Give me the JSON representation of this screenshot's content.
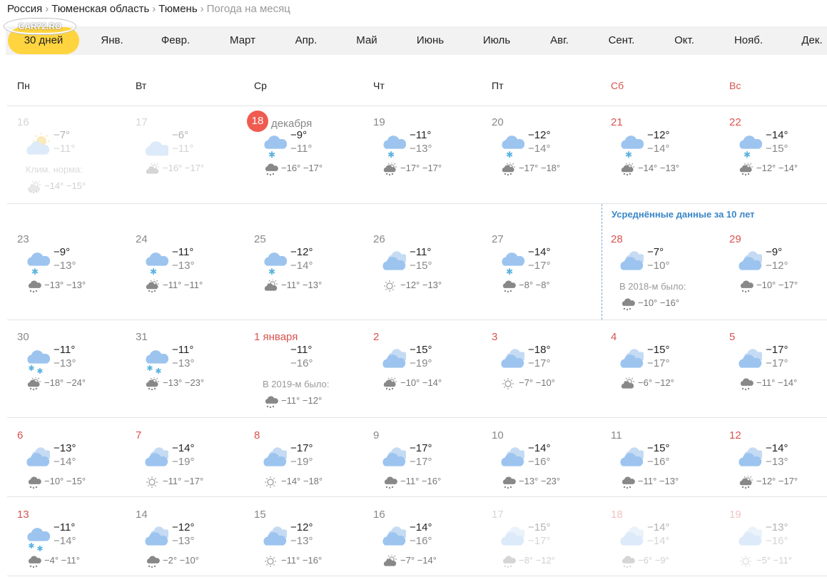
{
  "breadcrumb": [
    "Россия",
    "Тюменская область",
    "Тюмень"
  ],
  "breadcrumb_current": "Погода на месяц",
  "watermark": "CAR72.RO",
  "months": [
    "30 дней",
    "Янв.",
    "Февр.",
    "Март",
    "Апр.",
    "Май",
    "Июнь",
    "Июль",
    "Авг.",
    "Сент.",
    "Окт.",
    "Нояб.",
    "Дек."
  ],
  "active_month": "30 дней",
  "weekdays": [
    "Пн",
    "Вт",
    "Ср",
    "Чт",
    "Пт",
    "Сб",
    "Вс"
  ],
  "avg_label": "Усреднённые данные за 10 лет",
  "colors": {
    "accent": "#ffd43f",
    "today": "#f05b4f",
    "weekend": "#d9534f",
    "avg": "#3a86c8"
  },
  "days": [
    {
      "num": "16",
      "hi": "−7°",
      "lo": "−11°",
      "icon": "sun-cloud",
      "note": "Клим. норма:",
      "norm": "−14° −15°",
      "norm_icon": "sun-cloud-small",
      "faded": true
    },
    {
      "num": "17",
      "hi": "−6°",
      "lo": "−11°",
      "icon": "cloud",
      "norm": "−16° −17°",
      "norm_icon": "cloud-sun-small",
      "faded": true
    },
    {
      "num": "18",
      "month": "декабря",
      "today": true,
      "hi": "−9°",
      "lo": "−11°",
      "icon": "cloud-snow",
      "norm": "−16° −17°",
      "norm_icon": "cloud-snow-small"
    },
    {
      "num": "19",
      "hi": "−11°",
      "lo": "−13°",
      "icon": "cloud-snow",
      "norm": "−17° −17°",
      "norm_icon": "sun-cloud-snow-small"
    },
    {
      "num": "20",
      "hi": "−12°",
      "lo": "−14°",
      "icon": "cloud-snow",
      "norm": "−17° −18°",
      "norm_icon": "sun-cloud-snow-small"
    },
    {
      "num": "21",
      "hi": "−12°",
      "lo": "−14°",
      "icon": "cloud-snow",
      "norm": "−14° −13°",
      "norm_icon": "sun-cloud-snow-small",
      "weekend": true
    },
    {
      "num": "22",
      "hi": "−14°",
      "lo": "−15°",
      "icon": "cloud-snow",
      "norm": "−12° −14°",
      "norm_icon": "sun-cloud-snow-small",
      "weekend": true
    },
    {
      "num": "23",
      "hi": "−9°",
      "lo": "−13°",
      "icon": "cloud-snow",
      "norm": "−13° −13°",
      "norm_icon": "cloud-snow-small"
    },
    {
      "num": "24",
      "hi": "−11°",
      "lo": "−13°",
      "icon": "cloud-snow",
      "norm": "−11° −11°",
      "norm_icon": "sun-cloud-snow-small"
    },
    {
      "num": "25",
      "hi": "−12°",
      "lo": "−14°",
      "icon": "cloud-snow",
      "norm": "−11° −13°",
      "norm_icon": "cloud-sun-small"
    },
    {
      "num": "26",
      "hi": "−11°",
      "lo": "−15°",
      "icon": "clouds",
      "norm": "−12° −13°",
      "norm_icon": "sun-small"
    },
    {
      "num": "27",
      "hi": "−14°",
      "lo": "−17°",
      "icon": "cloud-snow",
      "norm": "−8° −8°",
      "norm_icon": "cloud-snow-small"
    },
    {
      "num": "28",
      "hi": "−7°",
      "lo": "−10°",
      "icon": "clouds",
      "note": "В 2018-м было:",
      "norm": "−10° −16°",
      "norm_icon": "cloud-snow-small",
      "weekend": true
    },
    {
      "num": "29",
      "hi": "−9°",
      "lo": "−12°",
      "icon": "clouds",
      "norm": "−10° −17°",
      "norm_icon": "cloud-snow-small",
      "weekend": true
    },
    {
      "num": "30",
      "hi": "−11°",
      "lo": "−13°",
      "icon": "cloud-snow-2",
      "norm": "−18° −24°",
      "norm_icon": "sun-cloud-snow-small"
    },
    {
      "num": "31",
      "hi": "−11°",
      "lo": "−13°",
      "icon": "cloud-snow-2",
      "norm": "−13° −23°",
      "norm_icon": "sun-cloud-snow-small"
    },
    {
      "num": "1 января",
      "hi": "−11°",
      "lo": "−16°",
      "icon": "none",
      "note": "В 2019-м было:",
      "norm": "−11° −12°",
      "norm_icon": "cloud-snow-small",
      "holiday": true
    },
    {
      "num": "2",
      "hi": "−15°",
      "lo": "−19°",
      "icon": "clouds",
      "norm": "−10° −14°",
      "norm_icon": "sun-cloud-snow-small",
      "holiday": true
    },
    {
      "num": "3",
      "hi": "−18°",
      "lo": "−17°",
      "icon": "clouds",
      "norm": "−7° −10°",
      "norm_icon": "sun-small",
      "holiday": true
    },
    {
      "num": "4",
      "hi": "−15°",
      "lo": "−17°",
      "icon": "clouds",
      "norm": "−6° −12°",
      "norm_icon": "cloud-sun-small",
      "holiday": true
    },
    {
      "num": "5",
      "hi": "−17°",
      "lo": "−17°",
      "icon": "clouds",
      "norm": "−11° −14°",
      "norm_icon": "cloud-snow-small",
      "holiday": true
    },
    {
      "num": "6",
      "hi": "−13°",
      "lo": "−14°",
      "icon": "clouds",
      "norm": "−10° −15°",
      "norm_icon": "cloud-snow-small",
      "holiday": true
    },
    {
      "num": "7",
      "hi": "−14°",
      "lo": "−19°",
      "icon": "clouds",
      "norm": "−11° −17°",
      "norm_icon": "sun-small",
      "holiday": true
    },
    {
      "num": "8",
      "hi": "−17°",
      "lo": "−19°",
      "icon": "clouds",
      "norm": "−14° −18°",
      "norm_icon": "sun-small",
      "holiday": true
    },
    {
      "num": "9",
      "hi": "−17°",
      "lo": "−17°",
      "icon": "clouds",
      "norm": "−11° −16°",
      "norm_icon": "cloud-snow-small"
    },
    {
      "num": "10",
      "hi": "−14°",
      "lo": "−16°",
      "icon": "clouds",
      "norm": "−13° −23°",
      "norm_icon": "cloud-snow-small"
    },
    {
      "num": "11",
      "hi": "−15°",
      "lo": "−16°",
      "icon": "clouds",
      "norm": "−11° −13°",
      "norm_icon": "cloud-snow-small"
    },
    {
      "num": "12",
      "hi": "−14°",
      "lo": "−13°",
      "icon": "clouds",
      "norm": "−12° −17°",
      "norm_icon": "sun-cloud-snow-small",
      "weekend": true
    },
    {
      "num": "13",
      "hi": "−11°",
      "lo": "−14°",
      "icon": "cloud-snow-2",
      "norm": "−4° −11°",
      "norm_icon": "cloud-snow-small",
      "weekend": true
    },
    {
      "num": "14",
      "hi": "−12°",
      "lo": "−13°",
      "icon": "clouds",
      "norm": "−2° −10°",
      "norm_icon": "cloud-snow-small"
    },
    {
      "num": "15",
      "hi": "−12°",
      "lo": "−13°",
      "icon": "clouds",
      "norm": "−11° −16°",
      "norm_icon": "sun-small"
    },
    {
      "num": "16",
      "hi": "−14°",
      "lo": "−16°",
      "icon": "clouds",
      "norm": "−7° −14°",
      "norm_icon": "cloud-sun-small"
    },
    {
      "num": "17",
      "hi": "−15°",
      "lo": "−17°",
      "icon": "clouds",
      "norm": "−8° −12°",
      "norm_icon": "cloud-snow-small",
      "faded": true
    },
    {
      "num": "18",
      "hi": "−14°",
      "lo": "−14°",
      "icon": "clouds",
      "norm": "−6° −9°",
      "norm_icon": "cloud-snow-small",
      "faded": true,
      "weekend": true
    },
    {
      "num": "19",
      "hi": "−13°",
      "lo": "−16°",
      "icon": "clouds",
      "norm": "−5° −11°",
      "norm_icon": "sun-small",
      "faded": true,
      "weekend": true
    }
  ]
}
